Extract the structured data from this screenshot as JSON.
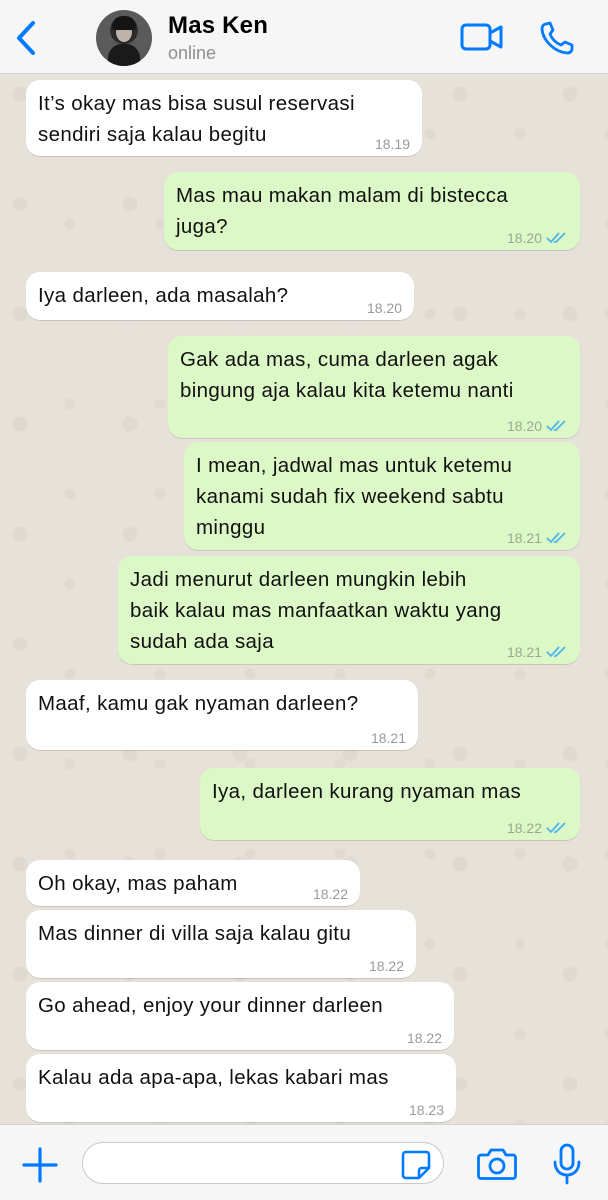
{
  "header": {
    "contact_name": "Mas Ken",
    "status": "online",
    "back_icon": "chevron-left-icon",
    "video_icon": "video-camera-icon",
    "call_icon": "phone-icon"
  },
  "colors": {
    "accent": "#007aff",
    "incoming_bubble": "#ffffff",
    "outgoing_bubble": "#dcf8c6",
    "read_tick": "#4fb6ec",
    "chat_background": "#e7e2d9"
  },
  "messages": [
    {
      "direction": "incoming",
      "text": "It’s okay mas bisa susul reservasi\nsendiri saja kalau begitu",
      "time": "18.19"
    },
    {
      "direction": "outgoing",
      "text": "Mas mau makan malam di bistecca\njuga?",
      "time": "18.20",
      "read": true
    },
    {
      "direction": "incoming",
      "text": "Iya darleen, ada masalah?",
      "time": "18.20"
    },
    {
      "direction": "outgoing",
      "text": "Gak ada mas, cuma darleen agak\nbingung aja kalau kita ketemu nanti",
      "time": "18.20",
      "read": true
    },
    {
      "direction": "outgoing",
      "text": "I mean, jadwal mas untuk ketemu\nkanami sudah fix weekend sabtu\nminggu",
      "time": "18.21",
      "read": true
    },
    {
      "direction": "outgoing",
      "text": "Jadi menurut darleen mungkin lebih\nbaik kalau mas manfaatkan waktu yang\nsudah ada saja",
      "time": "18.21",
      "read": true
    },
    {
      "direction": "incoming",
      "text": "Maaf, kamu gak nyaman darleen?",
      "time": "18.21"
    },
    {
      "direction": "outgoing",
      "text": "Iya, darleen kurang nyaman mas",
      "time": "18.22",
      "read": true
    },
    {
      "direction": "incoming",
      "text": "Oh okay, mas paham",
      "time": "18.22"
    },
    {
      "direction": "incoming",
      "text": "Mas dinner di villa saja kalau gitu",
      "time": "18.22"
    },
    {
      "direction": "incoming",
      "text": "Go ahead, enjoy your dinner darleen",
      "time": "18.22"
    },
    {
      "direction": "incoming",
      "text": "Kalau ada apa-apa, lekas kabari mas",
      "time": "18.23"
    }
  ],
  "input_bar": {
    "placeholder": "",
    "plus_icon": "plus-icon",
    "sticker_icon": "sticker-icon",
    "camera_icon": "camera-icon",
    "mic_icon": "microphone-icon"
  }
}
